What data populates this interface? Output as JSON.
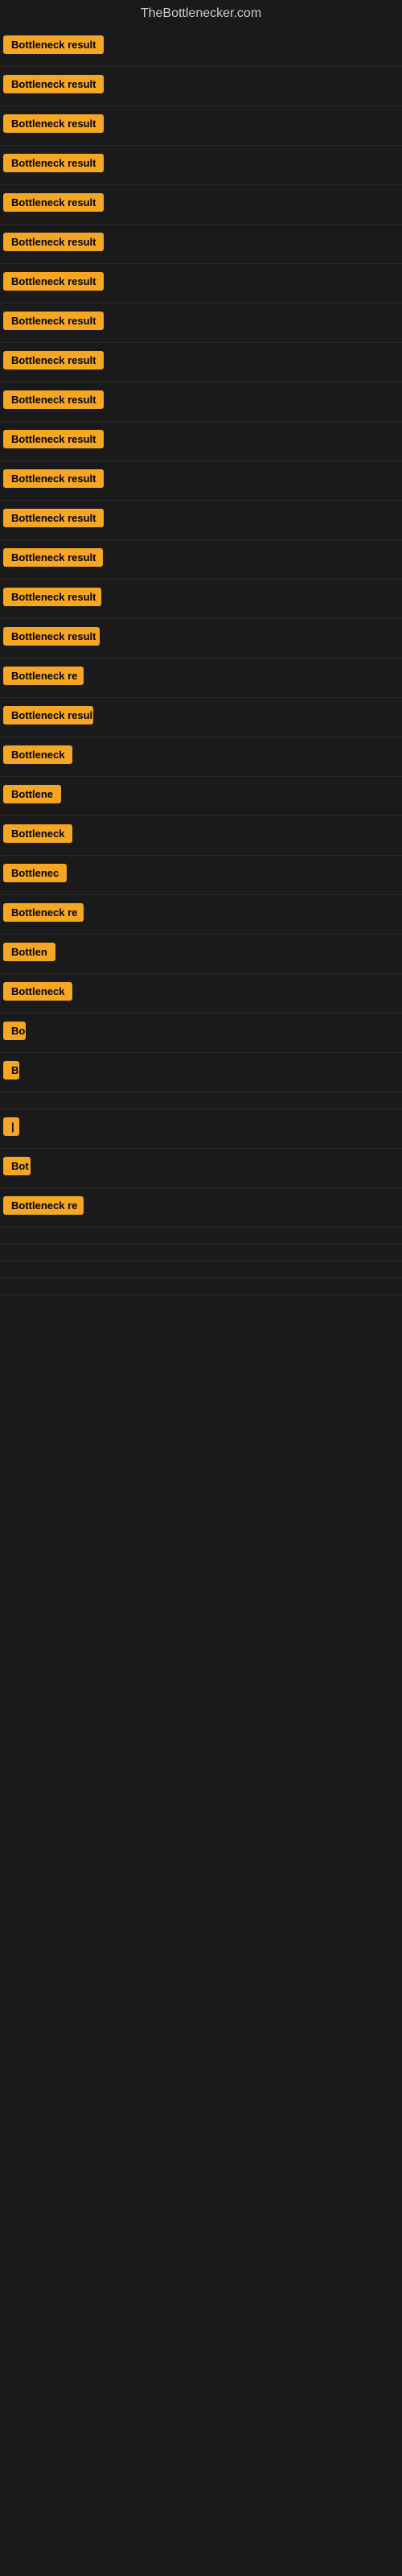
{
  "site": {
    "title": "TheBottlenecker.com"
  },
  "rows": [
    {
      "id": 1,
      "label": "Bottleneck result",
      "width": 140
    },
    {
      "id": 2,
      "label": "Bottleneck result",
      "width": 140
    },
    {
      "id": 3,
      "label": "Bottleneck result",
      "width": 140
    },
    {
      "id": 4,
      "label": "Bottleneck result",
      "width": 140
    },
    {
      "id": 5,
      "label": "Bottleneck result",
      "width": 140
    },
    {
      "id": 6,
      "label": "Bottleneck result",
      "width": 138
    },
    {
      "id": 7,
      "label": "Bottleneck result",
      "width": 138
    },
    {
      "id": 8,
      "label": "Bottleneck result",
      "width": 136
    },
    {
      "id": 9,
      "label": "Bottleneck result",
      "width": 134
    },
    {
      "id": 10,
      "label": "Bottleneck result",
      "width": 132
    },
    {
      "id": 11,
      "label": "Bottleneck result",
      "width": 130
    },
    {
      "id": 12,
      "label": "Bottleneck result",
      "width": 128
    },
    {
      "id": 13,
      "label": "Bottleneck result",
      "width": 126
    },
    {
      "id": 14,
      "label": "Bottleneck result",
      "width": 124
    },
    {
      "id": 15,
      "label": "Bottleneck result",
      "width": 122
    },
    {
      "id": 16,
      "label": "Bottleneck result",
      "width": 120
    },
    {
      "id": 17,
      "label": "Bottleneck re",
      "width": 100
    },
    {
      "id": 18,
      "label": "Bottleneck resul",
      "width": 112
    },
    {
      "id": 19,
      "label": "Bottleneck",
      "width": 90
    },
    {
      "id": 20,
      "label": "Bottlene",
      "width": 72
    },
    {
      "id": 21,
      "label": "Bottleneck",
      "width": 88
    },
    {
      "id": 22,
      "label": "Bottlenec",
      "width": 80
    },
    {
      "id": 23,
      "label": "Bottleneck re",
      "width": 100
    },
    {
      "id": 24,
      "label": "Bottlen",
      "width": 66
    },
    {
      "id": 25,
      "label": "Bottleneck",
      "width": 88
    },
    {
      "id": 26,
      "label": "Bo",
      "width": 28
    },
    {
      "id": 27,
      "label": "B",
      "width": 16
    },
    {
      "id": 28,
      "label": "",
      "width": 0
    },
    {
      "id": 29,
      "label": "|",
      "width": 10
    },
    {
      "id": 30,
      "label": "Bot",
      "width": 34
    },
    {
      "id": 31,
      "label": "Bottleneck re",
      "width": 100
    },
    {
      "id": 32,
      "label": "",
      "width": 0
    },
    {
      "id": 33,
      "label": "",
      "width": 0
    },
    {
      "id": 34,
      "label": "",
      "width": 0
    },
    {
      "id": 35,
      "label": "",
      "width": 0
    }
  ]
}
